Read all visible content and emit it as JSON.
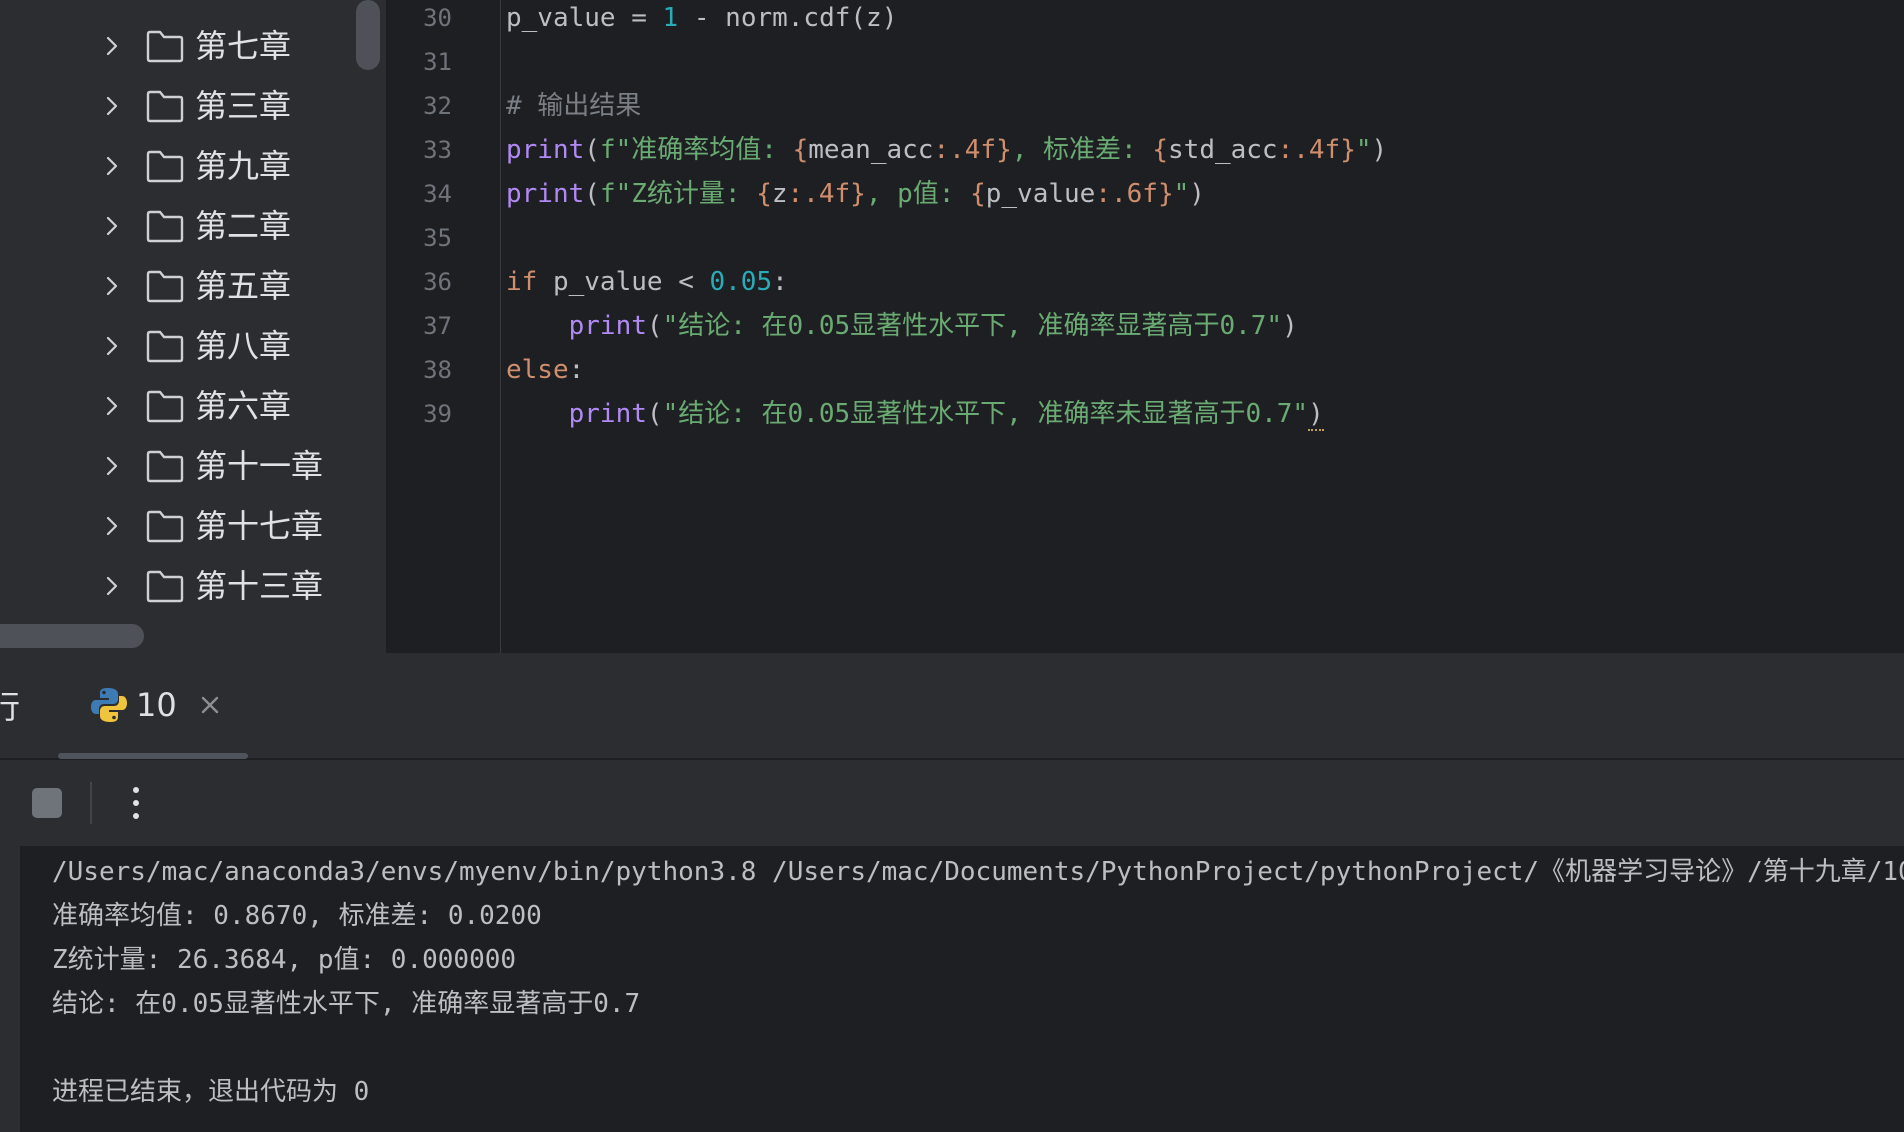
{
  "project_tree": {
    "items": [
      {
        "label": "第七章"
      },
      {
        "label": "第三章"
      },
      {
        "label": "第九章"
      },
      {
        "label": "第二章"
      },
      {
        "label": "第五章"
      },
      {
        "label": "第八章"
      },
      {
        "label": "第六章"
      },
      {
        "label": "第十一章"
      },
      {
        "label": "第十七章"
      },
      {
        "label": "第十三章"
      }
    ]
  },
  "editor": {
    "line_numbers": [
      "30",
      "31",
      "32",
      "33",
      "34",
      "35",
      "36",
      "37",
      "38",
      "39"
    ],
    "lines": {
      "l30": {
        "a": "p_value = ",
        "b": "1",
        "c": " - norm.cdf(z)"
      },
      "l32": {
        "comment": "# 输出结果"
      },
      "l33": {
        "fn": "print",
        "p1": "(",
        "s1": "f\"准确率均值: ",
        "b1": "{",
        "v1": "mean_acc",
        "f1": ":.4f",
        "b2": "}",
        "s2": ", 标准差: ",
        "b3": "{",
        "v2": "std_acc",
        "f2": ":.4f",
        "b4": "}",
        "s3": "\"",
        "p2": ")"
      },
      "l34": {
        "fn": "print",
        "p1": "(",
        "s1": "f\"Z统计量: ",
        "b1": "{",
        "v1": "z",
        "f1": ":.4f",
        "b2": "}",
        "s2": ", p值: ",
        "b3": "{",
        "v2": "p_value",
        "f2": ":.6f",
        "b4": "}",
        "s3": "\"",
        "p2": ")"
      },
      "l36": {
        "kw": "if",
        "a": " p_value < ",
        "num": "0.05",
        "b": ":"
      },
      "l37": {
        "indent": "    ",
        "fn": "print",
        "p1": "(",
        "s": "\"结论: 在0.05显著性水平下, 准确率显著高于0.7\"",
        "p2": ")"
      },
      "l38": {
        "kw": "else",
        "b": ":"
      },
      "l39": {
        "indent": "    ",
        "fn": "print",
        "p1": "(",
        "s": "\"结论: 在0.05显著性水平下, 准确率未显著高于0.7\"",
        "p2": ")"
      }
    }
  },
  "run_panel": {
    "title_fragment": "行",
    "tab_label": "10",
    "console_lines": [
      "/Users/mac/anaconda3/envs/myenv/bin/python3.8 /Users/mac/Documents/PythonProject/pythonProject/《机器学习导论》/第十九章/10",
      "准确率均值: 0.8670, 标准差: 0.0200",
      "Z统计量: 26.3684, p值: 0.000000",
      "结论: 在0.05显著性水平下, 准确率显著高于0.7",
      "",
      "进程已结束，退出代码为 0"
    ]
  },
  "colors": {
    "background": "#1e1f22",
    "panel": "#2b2d30",
    "keyword": "#cf8e6d",
    "function": "#b189f5",
    "number": "#2aacb8",
    "string": "#6aab73",
    "comment": "#7a7e85"
  },
  "icons": [
    "chevron-right-icon",
    "folder-icon",
    "python-icon",
    "close-icon",
    "stop-icon",
    "more-vertical-icon"
  ]
}
